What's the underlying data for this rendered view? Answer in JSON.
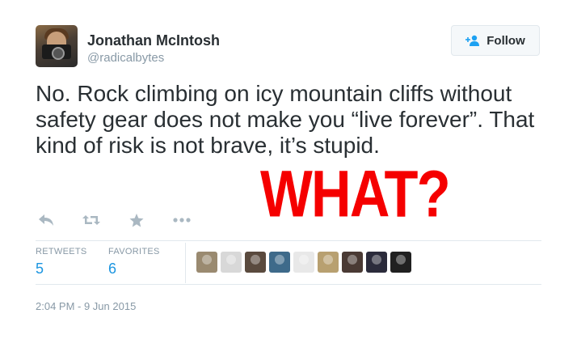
{
  "user": {
    "name": "Jonathan McIntosh",
    "handle": "@radicalbytes"
  },
  "follow_button": {
    "label": "Follow"
  },
  "tweet": {
    "text": "No. Rock climbing on icy mountain cliffs without safety gear does not make you “live forever”. That kind of risk is not brave, it’s stupid."
  },
  "overlay_text": "WHAT?",
  "actions": [
    "reply-icon",
    "retweet-icon",
    "favorite-icon",
    "more-icon"
  ],
  "stats": {
    "retweets_label": "RETWEETS",
    "retweets_count": "5",
    "favorites_label": "FAVORITES",
    "favorites_count": "6"
  },
  "favoriter_colors": [
    "#9a8a70",
    "#d8d8d8",
    "#5a4a3e",
    "#3e6a8a",
    "#e8e8e8",
    "#b8a070",
    "#4a3a34",
    "#2b2b3b",
    "#202020"
  ],
  "timestamp": "2:04 PM - 9 Jun 2015"
}
